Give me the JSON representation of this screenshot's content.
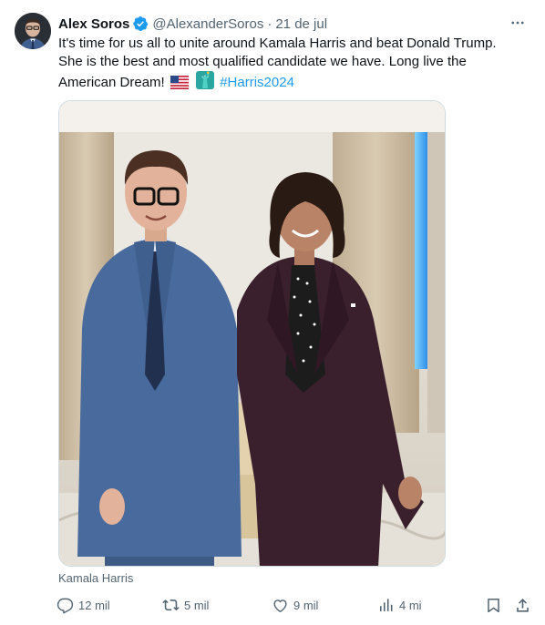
{
  "author": {
    "name": "Alex Soros",
    "handle": "@AlexanderSoros",
    "separator": "·",
    "date": "21 de jul"
  },
  "tweet": {
    "text": "It's time for us all to unite around Kamala Harris and beat Donald Trump. She is the best and most qualified candidate we have. Long live the American Dream!",
    "hashtag": "#Harris2024"
  },
  "media": {
    "caption": "Kamala Harris"
  },
  "actions": {
    "replies": "12 mil",
    "reposts": "5 mil",
    "likes": "9 mil",
    "views": "4 mi"
  },
  "icons": {
    "verified": "verified-badge-icon",
    "more": "more-icon",
    "reply": "reply-icon",
    "repost": "repost-icon",
    "like": "heart-icon",
    "views": "views-icon",
    "bookmark": "bookmark-icon",
    "share": "share-icon",
    "flag": "us-flag-emoji",
    "liberty": "statue-of-liberty-emoji"
  },
  "colors": {
    "accent": "#1d9bf0",
    "text": "#0f1419",
    "secondary": "#536471"
  }
}
